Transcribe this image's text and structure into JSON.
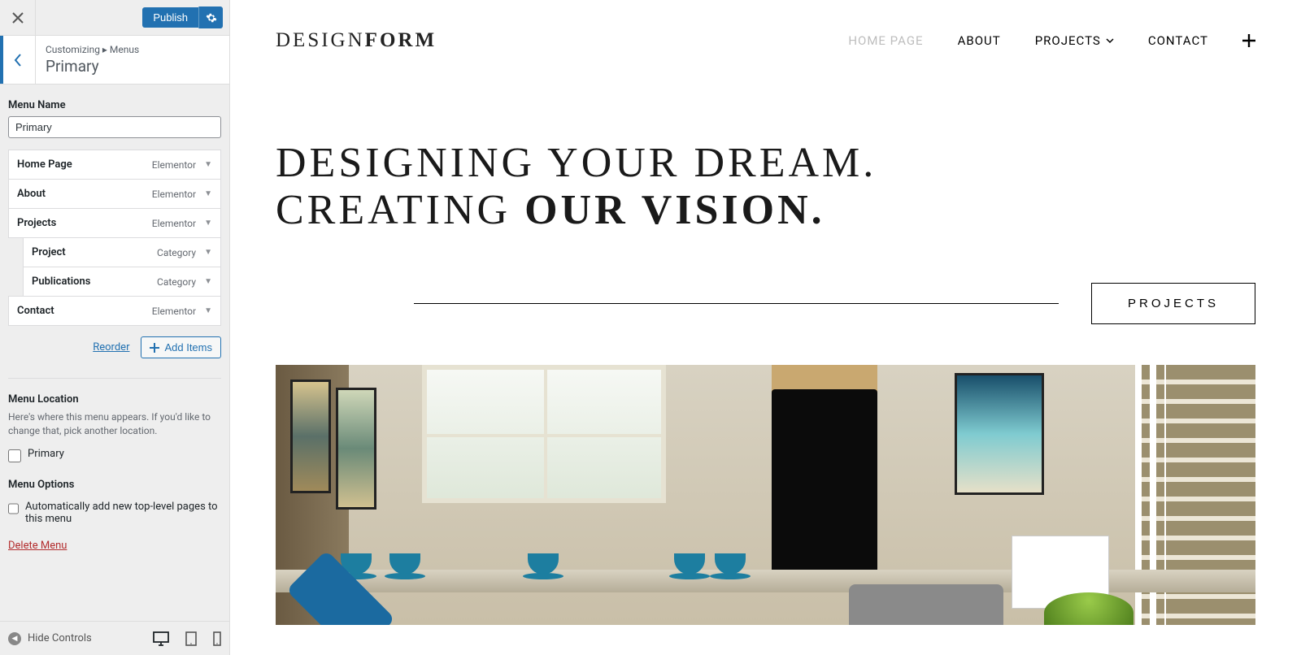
{
  "sidebar": {
    "publish_label": "Publish",
    "breadcrumb": "Customizing ▸ Menus",
    "panel_title": "Primary",
    "menu_name_label": "Menu Name",
    "menu_name_value": "Primary",
    "items": [
      {
        "label": "Home Page",
        "type": "Elementor",
        "level": 0
      },
      {
        "label": "About",
        "type": "Elementor",
        "level": 0
      },
      {
        "label": "Projects",
        "type": "Elementor",
        "level": 0
      },
      {
        "label": "Project",
        "type": "Category",
        "level": 1
      },
      {
        "label": "Publications",
        "type": "Category",
        "level": 1
      },
      {
        "label": "Contact",
        "type": "Elementor",
        "level": 0
      }
    ],
    "reorder_label": "Reorder",
    "add_items_label": "Add Items",
    "menu_location_heading": "Menu Location",
    "menu_location_desc": "Here's where this menu appears. If you'd like to change that, pick another location.",
    "location_checkbox_label": "Primary",
    "menu_options_heading": "Menu Options",
    "auto_add_label": "Automatically add new top-level pages to this menu",
    "delete_menu_label": "Delete Menu",
    "hide_controls_label": "Hide Controls"
  },
  "preview": {
    "logo_thin": "DESIGN",
    "logo_bold": "FORM",
    "nav": [
      "HOME PAGE",
      "ABOUT",
      "PROJECTS",
      "CONTACT"
    ],
    "hero_line1": "DESIGNING YOUR DREAM.",
    "hero_line2a": "CREATING ",
    "hero_line2b": "OUR VISION.",
    "projects_btn": "PROJECTS"
  }
}
